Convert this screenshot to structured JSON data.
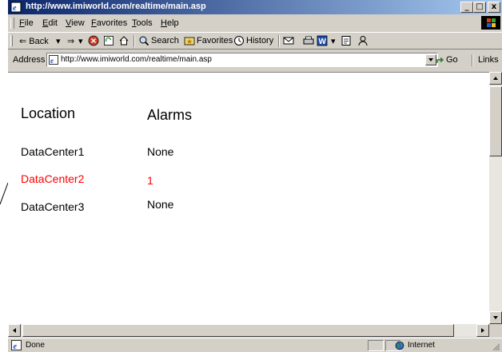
{
  "window": {
    "title": "http://www.imiworld.com/realtime/main.asp",
    "buttons": [
      "_",
      "□",
      "x"
    ]
  },
  "menu": [
    "File",
    "Edit",
    "View",
    "Favorites",
    "Tools",
    "Help"
  ],
  "toolbar": {
    "back": "⇐ Back",
    "back_dd": "▾",
    "forward": "⇒",
    "forward_dd": "▾",
    "search": "Search",
    "favorites": "Favorites",
    "history": "History"
  },
  "address": {
    "label": "Address",
    "url": "http://www.imiworld.com/realtime/main.asp",
    "go": "Go",
    "links": "Links"
  },
  "table": {
    "headers": [
      "Location",
      "Alarms"
    ],
    "rows": [
      {
        "location": "DataCenter1",
        "alarms": "None",
        "alert": false
      },
      {
        "location": "DataCenter2",
        "alarms": "1",
        "alert": true
      },
      {
        "location": "DataCenter3",
        "alarms": "None",
        "alert": false
      }
    ],
    "alert_color": "#ff0000"
  },
  "status": {
    "text": "Done",
    "zone": "Internet"
  }
}
